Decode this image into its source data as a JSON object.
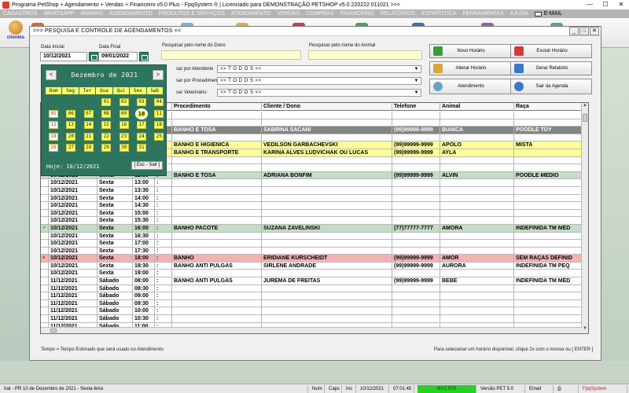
{
  "app": {
    "title": "Programa PetShop + Agendamento + Vendas + Financeiro v5.0 Plus - FpqSystem ® | Licenciado para  DEMONSTRAÇÃO PETSHOP v5.0 220222 011021 >>>",
    "menu": [
      "CADASTROS",
      "WHATSAPP",
      "ANIMAIS",
      "AGENDAMENTO",
      "PRODUTOS E SERVIÇOS",
      "ATENDIMENTO",
      "VENDAS",
      "COMPRAS",
      "FINANCEIRO",
      "RELATÓRIOS",
      "ESTATÍSTICA",
      "FERRAMENTAS",
      "AJUDA"
    ],
    "menu_email": "E-MAIL",
    "toolbar_clientes": "clientes"
  },
  "child": {
    "title": ">>>  PESQUISA E CONTROLE DE AGENDAMENTOS  <<",
    "data_inicial_label": "Data Inicial",
    "data_inicial": "10/12/2021",
    "data_final_label": "Data Final",
    "data_final": "09/01/2022",
    "dono_label": "Pesquisar pelo nome do Dono",
    "dono_value": "",
    "animal_label": "Pesquisar pelo nome do Animal",
    "animal_value": "",
    "atendente_label": "sar por Atendente",
    "procedimento_label": "sar por Procedimento",
    "veterinario_label": "sar Veterinário",
    "todos": ">> T O D O S <<",
    "buttons": {
      "novo": "Novo Horário",
      "excluir": "Excluir Horário",
      "alterar": "Alterar Horário",
      "relatorio": "Gerar Relatório",
      "atendimento": "Atendimento",
      "sair": "Sair da Agenda"
    }
  },
  "calendar": {
    "month_title": "Dezembro de 2021",
    "prev": "<",
    "next": ">",
    "weekdays": [
      "Dom",
      "Seg",
      "Ter",
      "Qua",
      "Qui",
      "Sex",
      "Sab"
    ],
    "selected_day": 10,
    "today_label": "Hoje: 10/12/2021",
    "close_label": "[ Esc - Sair ]"
  },
  "grid": {
    "columns": [
      "Procedimento",
      "Cliente / Dono",
      "Telefone",
      "Animal",
      "Raça"
    ],
    "rows": [
      {
        "style": "",
        "mark": "",
        "date": "",
        "day": "",
        "time": "",
        "proc": "",
        "client": "",
        "phone": "",
        "animal": "",
        "breed": ""
      },
      {
        "style": "",
        "mark": "",
        "date": "",
        "day": "",
        "time": "",
        "proc": "",
        "client": "",
        "phone": "",
        "animal": "",
        "breed": ""
      },
      {
        "style": "gray",
        "mark": "",
        "date": "",
        "day": "",
        "time": "",
        "proc": "BANHO E TOSA",
        "client": "SABRINA SACANI",
        "phone": "(99)99999-9999",
        "animal": "BIANCA",
        "breed": "POODLE TOY"
      },
      {
        "style": "",
        "mark": "",
        "date": "",
        "day": "",
        "time": "",
        "proc": "",
        "client": "",
        "phone": "",
        "animal": "",
        "breed": ""
      },
      {
        "style": "yellow",
        "mark": "",
        "date": "",
        "day": "",
        "time": "",
        "proc": "BANHO E HIGIENICA",
        "client": "VEDILSON GARBACHEVSKI",
        "phone": "(99)99999-9999",
        "animal": "APOLO",
        "breed": "MISTA"
      },
      {
        "style": "yellow",
        "mark": "",
        "date": "",
        "day": "",
        "time": "",
        "proc": "BANHO E TRANSPORTE",
        "client": "KARINA ALVES LUDVICHAK OU LUCAS",
        "phone": "(99)99999-9999",
        "animal": "AYLA",
        "breed": ""
      },
      {
        "style": "",
        "mark": "",
        "date": "",
        "day": "",
        "time": "",
        "proc": "",
        "client": "",
        "phone": "",
        "animal": "",
        "breed": ""
      },
      {
        "style": "",
        "mark": "",
        "date": "",
        "day": "",
        "time": "",
        "proc": "",
        "client": "",
        "phone": "",
        "animal": "",
        "breed": ""
      },
      {
        "style": "green",
        "mark": "✓",
        "date": "10/12/2021",
        "day": "Sexta",
        "time": "12:30",
        "proc": "BANHO E TOSA",
        "client": "ADRIANA BONFIM",
        "phone": "(99)99999-9999",
        "animal": "ALVIN",
        "breed": "POODLE MEDIO"
      },
      {
        "style": "",
        "mark": "",
        "date": "10/12/2021",
        "day": "Sexta",
        "time": "13:00",
        "proc": "",
        "client": "",
        "phone": "",
        "animal": "",
        "breed": ""
      },
      {
        "style": "",
        "mark": "",
        "date": "10/12/2021",
        "day": "Sexta",
        "time": "13:30",
        "proc": "",
        "client": "",
        "phone": "",
        "animal": "",
        "breed": ""
      },
      {
        "style": "",
        "mark": "",
        "date": "10/12/2021",
        "day": "Sexta",
        "time": "14:00",
        "proc": "",
        "client": "",
        "phone": "",
        "animal": "",
        "breed": ""
      },
      {
        "style": "",
        "mark": "",
        "date": "10/12/2021",
        "day": "Sexta",
        "time": "14:30",
        "proc": "",
        "client": "",
        "phone": "",
        "animal": "",
        "breed": ""
      },
      {
        "style": "",
        "mark": "",
        "date": "10/12/2021",
        "day": "Sexta",
        "time": "15:00",
        "proc": "",
        "client": "",
        "phone": "",
        "animal": "",
        "breed": ""
      },
      {
        "style": "",
        "mark": "",
        "date": "10/12/2021",
        "day": "Sexta",
        "time": "15:30",
        "proc": "",
        "client": "",
        "phone": "",
        "animal": "",
        "breed": ""
      },
      {
        "style": "green",
        "mark": "✓",
        "date": "10/12/2021",
        "day": "Sexta",
        "time": "16:00",
        "proc": "BANHO PACOTE",
        "client": "SUZANA ZAVELINSKI",
        "phone": "(77)77777-7777",
        "animal": "AMORA",
        "breed": "INDEFINIDA TM MÉD"
      },
      {
        "style": "",
        "mark": "",
        "date": "10/12/2021",
        "day": "Sexta",
        "time": "16:30",
        "proc": "",
        "client": "",
        "phone": "",
        "animal": "",
        "breed": ""
      },
      {
        "style": "",
        "mark": "",
        "date": "10/12/2021",
        "day": "Sexta",
        "time": "17:00",
        "proc": "",
        "client": "",
        "phone": "",
        "animal": "",
        "breed": ""
      },
      {
        "style": "",
        "mark": "",
        "date": "10/12/2021",
        "day": "Sexta",
        "time": "17:30",
        "proc": "",
        "client": "",
        "phone": "",
        "animal": "",
        "breed": ""
      },
      {
        "style": "pink",
        "mark": "x",
        "date": "10/12/2021",
        "day": "Sexta",
        "time": "18:00",
        "proc": "BANHO",
        "client": "ERIDIANE KURSCHEIDT",
        "phone": "(99)99999-9999",
        "animal": "AMOR",
        "breed": "SEM RAÇAS DEFINID"
      },
      {
        "style": "",
        "mark": "",
        "date": "10/12/2021",
        "day": "Sexta",
        "time": "18:30",
        "proc": "BANHO ANTI PULGAS",
        "client": "SIRLENE ANDRADE",
        "phone": "(99)99999-9999",
        "animal": "AURORA",
        "breed": "INDEFINIDA TM PEQ"
      },
      {
        "style": "",
        "mark": "",
        "date": "10/12/2021",
        "day": "Sexta",
        "time": "19:00",
        "proc": "",
        "client": "",
        "phone": "",
        "animal": "",
        "breed": ""
      },
      {
        "style": "",
        "mark": "",
        "date": "11/12/2021",
        "day": "Sábado",
        "time": "08:00",
        "proc": "BANHO ANTI PULGAS",
        "client": "JUREMA DE FREITAS",
        "phone": "(99)99999-9999",
        "animal": "BEBE",
        "breed": "INDEFINIDA TM MÉD"
      },
      {
        "style": "",
        "mark": "",
        "date": "11/12/2021",
        "day": "Sábado",
        "time": "08:30",
        "proc": "",
        "client": "",
        "phone": "",
        "animal": "",
        "breed": ""
      },
      {
        "style": "",
        "mark": "",
        "date": "11/12/2021",
        "day": "Sábado",
        "time": "09:00",
        "proc": "",
        "client": "",
        "phone": "",
        "animal": "",
        "breed": ""
      },
      {
        "style": "",
        "mark": "",
        "date": "11/12/2021",
        "day": "Sábado",
        "time": "09:30",
        "proc": "",
        "client": "",
        "phone": "",
        "animal": "",
        "breed": ""
      },
      {
        "style": "",
        "mark": "",
        "date": "11/12/2021",
        "day": "Sábado",
        "time": "10:00",
        "proc": "",
        "client": "",
        "phone": "",
        "animal": "",
        "breed": ""
      },
      {
        "style": "",
        "mark": "",
        "date": "11/12/2021",
        "day": "Sábado",
        "time": "10:30",
        "proc": "",
        "client": "",
        "phone": "",
        "animal": "",
        "breed": ""
      },
      {
        "style": "",
        "mark": "",
        "date": "11/12/2021",
        "day": "Sábado",
        "time": "11:00",
        "proc": "",
        "client": "",
        "phone": "",
        "animal": "",
        "breed": ""
      }
    ]
  },
  "footer": {
    "tempo_note": "Tempo = Tempo Estimado que será usado no Atendimento",
    "select_note": "Para selecionar um horário disponível, clique 2x com o mouse ou [ ENTER ]"
  },
  "status": {
    "left": "Irat - PR 10 de Dezembro de 2021 - Sexta-feira",
    "num": "Num",
    "caps": "Caps",
    "ins": "Ins",
    "date": "10/12/2021",
    "time": "07:01:45",
    "master": "MASTER",
    "version": "Versão PET 5.0",
    "email": "Email",
    "brand": "FpqSystem"
  }
}
